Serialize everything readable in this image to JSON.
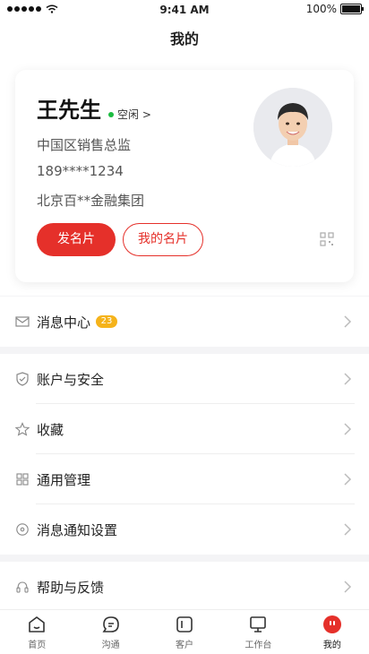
{
  "status_bar": {
    "time": "9:41 AM",
    "battery": "100%"
  },
  "nav": {
    "title": "我的"
  },
  "profile": {
    "name": "王先生",
    "status_text": "空闲 >",
    "title": "中国区销售总监",
    "phone": "189****1234",
    "company": "北京百**金融集团",
    "send_card_label": "发名片",
    "my_card_label": "我的名片"
  },
  "menu": {
    "message_center": {
      "label": "消息中心",
      "badge": "23"
    },
    "account_security": {
      "label": "账户与安全"
    },
    "favorites": {
      "label": "收藏"
    },
    "general": {
      "label": "通用管理"
    },
    "notify_settings": {
      "label": "消息通知设置"
    },
    "help": {
      "label": "帮助与反馈"
    }
  },
  "tabbar": {
    "home": "首页",
    "chat": "沟通",
    "customer": "客户",
    "workbench": "工作台",
    "mine": "我的"
  },
  "colors": {
    "accent": "#e5302a",
    "badge": "#f5b31b",
    "online": "#1cbc41"
  }
}
